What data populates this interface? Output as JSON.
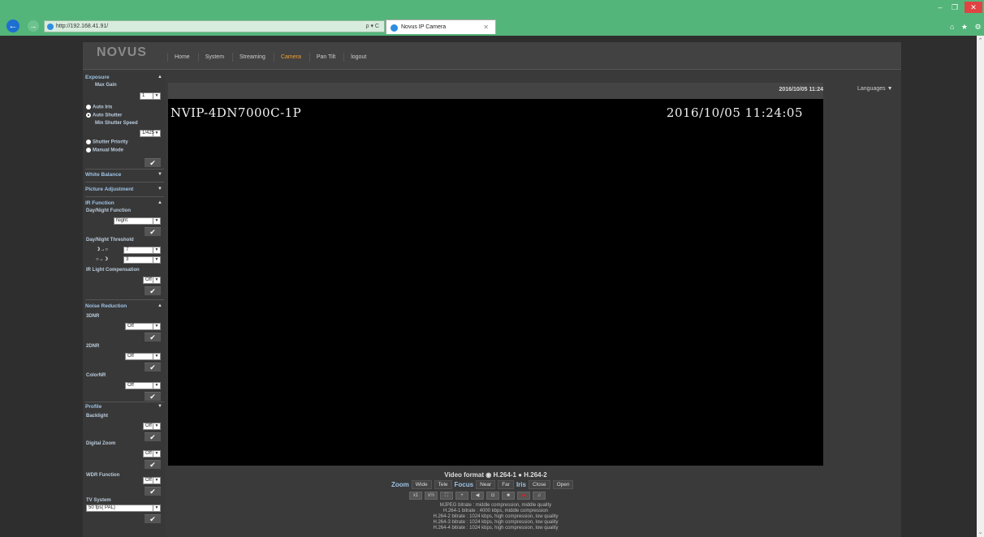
{
  "browser": {
    "url": "http://192.168.41.91/",
    "address_tools": "ρ ▾ C",
    "tab_title": "Novus IP Camera",
    "back": "←",
    "forward": "→",
    "right_icons": "⌂ ★ ⚙"
  },
  "header": {
    "logo": "NOVUS",
    "menu": [
      "Home",
      "System",
      "Streaming",
      "Camera",
      "Pan Tilt",
      "logout"
    ],
    "active": "Camera"
  },
  "sidebar": {
    "exposure": "Exposure",
    "max_gain": "Max Gain",
    "max_gain_value": "1",
    "auto_iris": "Auto Iris",
    "auto_shutter": "Auto Shutter",
    "min_shutter_speed": "Min Shutter Speed",
    "min_shutter_value": "1/425",
    "shutter_priority": "Shutter Priority",
    "manual_mode": "Manual Mode",
    "white_balance": "White Balance",
    "picture_adjustment": "Picture Adjustment",
    "ir_function": "IR Function",
    "day_night_function": "Day/Night Function",
    "day_night_value": "Night",
    "day_night_threshold": "Day/Night Threshold",
    "threshold_1": "7",
    "threshold_2": "3",
    "ir_light_comp": "IR Light Compensation",
    "ir_light_value": "Off",
    "noise_reduction": "Noise Reduction",
    "dnr3": "3DNR",
    "dnr3_value": "Off",
    "dnr2": "2DNR",
    "dnr2_value": "Off",
    "colornr": "ColorNR",
    "colornr_value": "Off",
    "profile": "Profile",
    "backlight": "Backlight",
    "backlight_value": "Off",
    "digital_zoom": "Digital Zoom",
    "digital_zoom_value": "Off",
    "wdr_function": "WDR Function",
    "wdr_value": "Off",
    "tv_system": "TV System",
    "tv_value": "50 fps( PAL)"
  },
  "video": {
    "timestamp": "2016/10/05 11:24",
    "osd_name": "NVIP-4DN7000C-1P",
    "osd_time": "2016/10/05 11:24:05",
    "languages": "Languages ▼"
  },
  "controls": {
    "video_format": "Video format",
    "format_1": "H.264-1",
    "format_2": "H.264-2",
    "zoom": "Zoom",
    "wide": "Wide",
    "tele": "Tele",
    "focus": "Focus",
    "near": "Near",
    "far": "Far",
    "iris": "Iris",
    "close": "Close",
    "open": "Open",
    "bitrates": [
      "MJPEG bitrate : middle compression, middle quality",
      "H.264-1 bitrate : 4000 kbps, middle compression",
      "H.264-2 bitrate : 1024 kbps, high compression, low quality",
      "H.264-3 bitrate : 1024 kbps, high compression, low quality",
      "H.264-4 bitrate : 1024 kbps, high compression, low quality"
    ]
  }
}
